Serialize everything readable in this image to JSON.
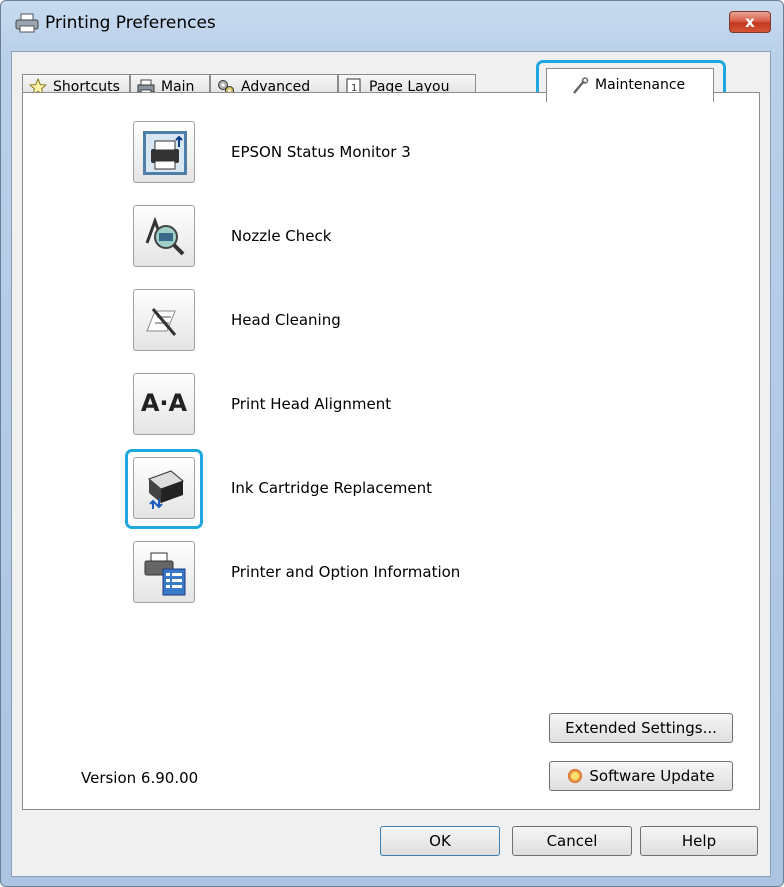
{
  "window": {
    "title": "Printing Preferences",
    "close_glyph": "x"
  },
  "tabs": [
    {
      "label": "Shortcuts",
      "icon": "star-icon"
    },
    {
      "label": "Main",
      "icon": "printer-icon"
    },
    {
      "label": "Advanced",
      "icon": "gears-icon"
    },
    {
      "label": "Page Layou",
      "icon": "page-layout-icon"
    },
    {
      "label": "Maintenance",
      "icon": "wrench-icon",
      "active": true
    }
  ],
  "maintenance_items": [
    {
      "label": "EPSON Status Monitor 3",
      "icon": "status-monitor-icon"
    },
    {
      "label": "Nozzle Check",
      "icon": "nozzle-check-icon"
    },
    {
      "label": "Head Cleaning",
      "icon": "head-cleaning-icon"
    },
    {
      "label": "Print Head Alignment",
      "icon": "alignment-icon",
      "glyph": "A·A"
    },
    {
      "label": "Ink Cartridge Replacement",
      "icon": "ink-cartridge-icon",
      "highlighted": true
    },
    {
      "label": "Printer and Option Information",
      "icon": "printer-info-icon"
    }
  ],
  "buttons": {
    "extended_settings": "Extended Settings...",
    "software_update": "Software Update",
    "ok": "OK",
    "cancel": "Cancel",
    "help": "Help"
  },
  "version": "Version 6.90.00",
  "colors": {
    "highlight": "#1fa8df",
    "title_bar": "#b9d0ea",
    "close_button": "#c2381f"
  }
}
